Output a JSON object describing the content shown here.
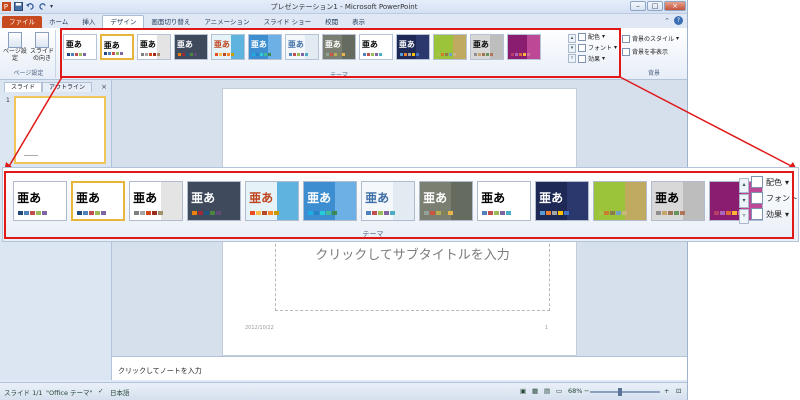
{
  "window": {
    "title": "プレゼンテーション1 - Microsoft PowerPoint",
    "qat_icons": [
      "save-icon",
      "undo-icon",
      "redo-icon"
    ]
  },
  "tabs": [
    {
      "label": "ファイル",
      "kind": "file"
    },
    {
      "label": "ホーム",
      "kind": ""
    },
    {
      "label": "挿入",
      "kind": ""
    },
    {
      "label": "デザイン",
      "kind": "active"
    },
    {
      "label": "画面切り替え",
      "kind": ""
    },
    {
      "label": "アニメーション",
      "kind": ""
    },
    {
      "label": "スライド ショー",
      "kind": ""
    },
    {
      "label": "校閲",
      "kind": ""
    },
    {
      "label": "表示",
      "kind": ""
    }
  ],
  "ribbon": {
    "page_setup": {
      "btn1": "ページ設定",
      "btn2": "スライドの向き",
      "group_label": "ページ設定"
    },
    "theme_group_label": "テーマ",
    "theme_options": {
      "colors": "配色",
      "fonts": "フォント",
      "effects": "効果"
    },
    "background": {
      "styles": "背景のスタイル",
      "hide": "背景を非表示",
      "group_label": "背景"
    }
  },
  "themes": [
    {
      "text": "亜あ",
      "bg": "#ffffff",
      "fg": "#000000",
      "accent": "#ffffff",
      "sw": [
        "#1f497d",
        "#4f81bd",
        "#c0504d",
        "#9bbb59",
        "#8064a2"
      ]
    },
    {
      "text": "亜あ",
      "bg": "#ffffff",
      "fg": "#000000",
      "accent": "#ffffff",
      "sw": [
        "#1f497d",
        "#4f81bd",
        "#c0504d",
        "#9bbb59",
        "#8064a2"
      ],
      "selected": true
    },
    {
      "text": "亜あ",
      "bg": "#ffffff",
      "fg": "#000000",
      "accent": "#dddddd",
      "sw": [
        "#7f7f7f",
        "#a5a5a5",
        "#d34817",
        "#9b2d1f",
        "#a28e6a"
      ]
    },
    {
      "text": "亜あ",
      "bg": "#3f4a5c",
      "fg": "#ffffff",
      "accent": "#3f4a5c",
      "sw": [
        "#f07f09",
        "#9f2936",
        "#1b587c",
        "#4e8542",
        "#604878"
      ]
    },
    {
      "text": "亜あ",
      "bg": "#e5f2f8",
      "fg": "#c0441c",
      "accent": "#3ca4d8",
      "sw": [
        "#e84c22",
        "#ffbd47",
        "#b64926",
        "#ff8427",
        "#cc9900"
      ]
    },
    {
      "text": "亜あ",
      "bg": "#3d8ed0",
      "fg": "#ffffff",
      "accent": "#79b9ea",
      "sw": [
        "#1cade4",
        "#2683c6",
        "#27ced7",
        "#42ba97",
        "#3e8853"
      ]
    },
    {
      "text": "亜あ",
      "bg": "#f5f8fb",
      "fg": "#3e6ea6",
      "accent": "#dfe7f0",
      "sw": [
        "#4f81bd",
        "#c0504d",
        "#9bbb59",
        "#8064a2",
        "#4bacc6"
      ]
    },
    {
      "text": "亜あ",
      "bg": "#7a7f72",
      "fg": "#ffffff",
      "accent": "#60665a",
      "sw": [
        "#93a299",
        "#cf543f",
        "#b5ae53",
        "#848058",
        "#e8b54d"
      ]
    },
    {
      "text": "亜あ",
      "bg": "#ffffff",
      "fg": "#000000",
      "accent": "#ffffff",
      "sw": [
        "#4f81bd",
        "#c0504d",
        "#9bbb59",
        "#8064a2",
        "#4bacc6"
      ]
    },
    {
      "text": "亜あ",
      "bg": "#1e2a55",
      "fg": "#ffffff",
      "accent": "#2d3c74",
      "sw": [
        "#5b9bd5",
        "#ed7d31",
        "#a5a5a5",
        "#ffc000",
        "#4472c4"
      ]
    },
    {
      "text": "",
      "bg": "#9cc43b",
      "fg": "#ffffff",
      "accent": "#c8a46a",
      "sw": [
        "#a5c249",
        "#cc7c2f",
        "#8c7b4c",
        "#74a0c6",
        "#c7b77d"
      ]
    },
    {
      "text": "亜あ",
      "bg": "#d8d8d8",
      "fg": "#000000",
      "accent": "#b7b7b7",
      "sw": [
        "#8f8f8f",
        "#c8a46a",
        "#9f7355",
        "#68935a",
        "#b1755a"
      ]
    },
    {
      "text": "",
      "bg": "#8a1d6f",
      "fg": "#ffffff",
      "accent": "#c9549f",
      "sw": [
        "#b83d68",
        "#ac66bb",
        "#de6c36",
        "#f9b639",
        "#cf6da4"
      ]
    }
  ],
  "left_pane": {
    "tab_slides": "スライド",
    "tab_outline": "アウトライン",
    "close": "×",
    "slide_number": "1"
  },
  "slide": {
    "subtitle_placeholder": "クリックしてサブタイトルを入力",
    "date": "2012/10/22",
    "number": "1"
  },
  "notes": {
    "placeholder": "クリックしてノートを入力"
  },
  "status": {
    "slide": "スライド 1/1",
    "theme": "\"Office テーマ\"",
    "language": "日本語",
    "zoom": "68%",
    "zoom_fraction": 0.43
  },
  "colors": {
    "highlight": "#e01818",
    "file_tab": "#c64a1d",
    "selected_border": "#e7b53b"
  }
}
